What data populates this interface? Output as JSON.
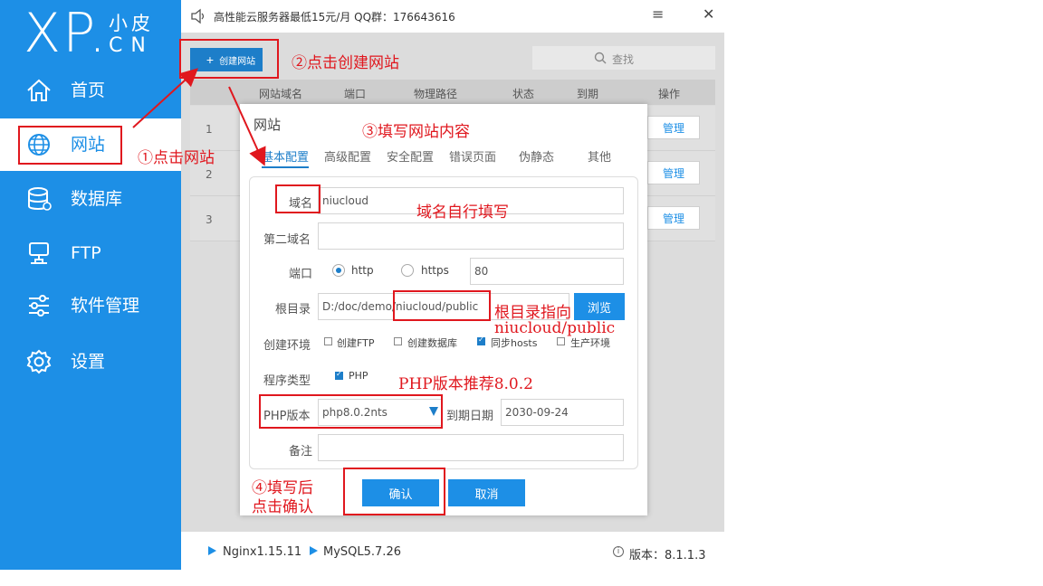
{
  "colors": {
    "primary": "#1d8fe6",
    "annotation": "#e0171e",
    "content_bg": "#dcdcdc"
  },
  "logo": {
    "text": "XP.",
    "cn1": "小皮",
    "cn2": "CN"
  },
  "sidebar": {
    "items": [
      {
        "label": "首页",
        "icon": "home-icon"
      },
      {
        "label": "网站",
        "icon": "globe-icon"
      },
      {
        "label": "数据库",
        "icon": "database-icon"
      },
      {
        "label": "FTP",
        "icon": "server-icon"
      },
      {
        "label": "软件管理",
        "icon": "sliders-icon"
      },
      {
        "label": "设置",
        "icon": "gear-icon"
      }
    ]
  },
  "titlebar": {
    "text": "高性能云服务器最低15元/月  QQ群：176643616",
    "menu": "≡",
    "close": "✕"
  },
  "toolbar": {
    "create_icon": "+",
    "create_label": "创建网站",
    "search_placeholder": "查找"
  },
  "table": {
    "headers": [
      "网站域名",
      "端口",
      "物理路径",
      "状态",
      "到期",
      "操作"
    ],
    "rows": [
      {
        "num": "1",
        "action": "管理"
      },
      {
        "num": "2",
        "action": "管理"
      },
      {
        "num": "3",
        "action": "管理"
      }
    ]
  },
  "status": {
    "nginx": "Nginx1.15.11",
    "mysql": "MySQL5.7.26",
    "version": "版本：8.1.1.3",
    "info": "i"
  },
  "dialog": {
    "title": "网站",
    "tabs": [
      "基本配置",
      "高级配置",
      "安全配置",
      "错误页面",
      "伪静态",
      "其他"
    ],
    "labels": {
      "domain": "域名",
      "second_domain": "第二域名",
      "port": "端口",
      "root": "根目录",
      "env": "创建环境",
      "program": "程序类型",
      "php_version": "PHP版本",
      "expire": "到期日期",
      "note": "备注"
    },
    "values": {
      "domain": "niucloud",
      "second_domain": "",
      "port": "80",
      "root": "D:/doc/demo/niucloud/public",
      "php": "php8.0.2nts",
      "expire": "2030-09-24",
      "note": ""
    },
    "radios": [
      "http",
      "https"
    ],
    "checks": [
      "创建FTP",
      "创建数据库",
      "同步hosts",
      "生产环境"
    ],
    "program_php": "PHP",
    "browse": "浏览",
    "confirm": "确认",
    "cancel": "取消"
  },
  "annotations": {
    "a1": "①点击网站",
    "a2": "②点击创建网站",
    "a3": "③填写网站内容",
    "a4_line1": "④填写后",
    "a4_line2": "点击确认",
    "domain_note": "域名自行填写",
    "root_note1": "根目录指向",
    "root_note2": "niucloud/public",
    "php_note": "PHP版本推荐8.0.2"
  }
}
